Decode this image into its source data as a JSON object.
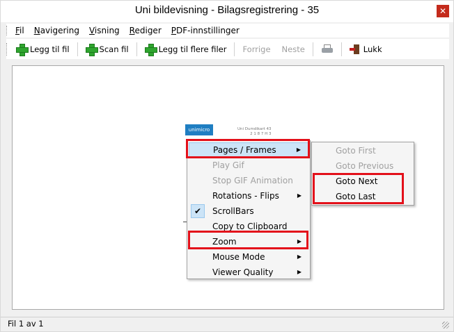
{
  "window": {
    "title": "Uni bildevisning - Bilagsregistrering - 35",
    "close_glyph": "✕"
  },
  "menubar": {
    "items": [
      {
        "mnemonic": "F",
        "rest": "il"
      },
      {
        "mnemonic": "N",
        "rest": "avigering"
      },
      {
        "mnemonic": "V",
        "rest": "isning"
      },
      {
        "mnemonic": "R",
        "rest": "ediger"
      },
      {
        "mnemonic": "P",
        "rest": "DF-innstillinger"
      }
    ]
  },
  "toolbar": {
    "add_file": "Legg til fil",
    "scan_file": "Scan fil",
    "add_multiple": "Legg til flere filer",
    "previous": "Forrige",
    "next": "Neste",
    "close": "Lukk",
    "icons": {
      "add": "plus-icon",
      "print": "printer-icon",
      "close": "exit-door-icon"
    }
  },
  "document_preview": {
    "logo_text": "unimicro",
    "header_text_line1": "Uni Dumdikart 43",
    "header_text_line2": "2 1 8 7 H 3"
  },
  "context_menu": {
    "items": [
      {
        "label": "Pages / Frames",
        "disabled": false,
        "submenu": true
      },
      {
        "label": "Play Gif",
        "disabled": true,
        "submenu": false
      },
      {
        "label": "Stop GIF Animation",
        "disabled": true,
        "submenu": false
      },
      {
        "label": "Rotations - Flips",
        "disabled": false,
        "submenu": true
      },
      {
        "label": "ScrollBars",
        "disabled": false,
        "submenu": false,
        "checked": true
      },
      {
        "label": "Copy to Clipboard",
        "disabled": false,
        "submenu": false
      },
      {
        "label": "Zoom",
        "disabled": false,
        "submenu": true
      },
      {
        "label": "Mouse Mode",
        "disabled": false,
        "submenu": true
      },
      {
        "label": "Viewer Quality",
        "disabled": false,
        "submenu": true
      }
    ],
    "arrow_glyph": "▶",
    "check_glyph": "✔"
  },
  "submenu": {
    "items": [
      {
        "label": "Goto First",
        "disabled": true
      },
      {
        "label": "Goto Previous",
        "disabled": true
      },
      {
        "label": "Goto Next",
        "disabled": false
      },
      {
        "label": "Goto Last",
        "disabled": false
      }
    ]
  },
  "status": {
    "text": "Fil 1 av 1"
  },
  "colors": {
    "highlight_outline": "#e3101a",
    "menu_hover": "#cce4f7",
    "close_button": "#c42b1c"
  }
}
